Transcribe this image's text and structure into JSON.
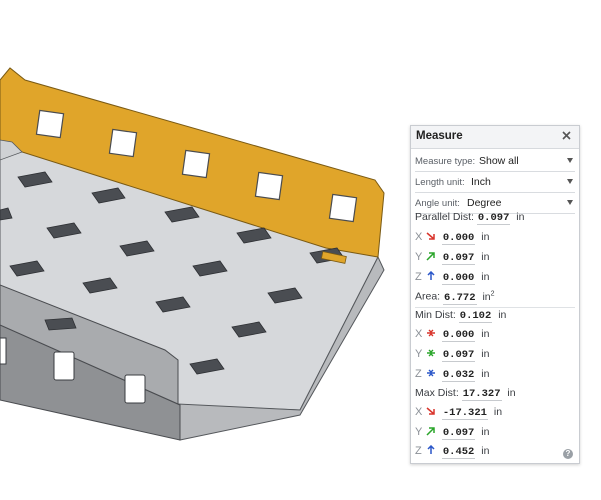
{
  "panel": {
    "title": "Measure",
    "measure_type_label": "Measure type:",
    "measure_type_value": "Show all",
    "length_unit_label": "Length unit:",
    "length_unit_value": "Inch",
    "angle_unit_label": "Angle unit:",
    "angle_unit_value": "Degree",
    "parallel_dist_label": "Parallel Dist:",
    "parallel_dist_value": "0.097",
    "parallel_dist_unit": "in",
    "parallel": {
      "x": {
        "axis": "X",
        "value": "0.000",
        "unit": "in"
      },
      "y": {
        "axis": "Y",
        "value": "0.097",
        "unit": "in"
      },
      "z": {
        "axis": "Z",
        "value": "0.000",
        "unit": "in"
      }
    },
    "area_label": "Area:",
    "area_value": "6.772",
    "area_unit": "in",
    "area_exp": "2",
    "min_dist_label": "Min Dist:",
    "min_dist_value": "0.102",
    "min_dist_unit": "in",
    "min": {
      "x": {
        "axis": "X",
        "value": "0.000",
        "unit": "in"
      },
      "y": {
        "axis": "Y",
        "value": "0.097",
        "unit": "in"
      },
      "z": {
        "axis": "Z",
        "value": "0.032",
        "unit": "in"
      }
    },
    "max_dist_label": "Max Dist:",
    "max_dist_value": "17.327",
    "max_dist_unit": "in",
    "max": {
      "x": {
        "axis": "X",
        "value": "-17.321",
        "unit": "in"
      },
      "y": {
        "axis": "Y",
        "value": "0.097",
        "unit": "in"
      },
      "z": {
        "axis": "Z",
        "value": "0.452",
        "unit": "in"
      }
    },
    "help_glyph": "?"
  },
  "colors": {
    "selected_face": "#e0a52a",
    "part_gray": "#d6d8db",
    "x_axis": "#d9342b",
    "y_axis": "#2aa52a",
    "z_axis": "#2b57c9"
  }
}
